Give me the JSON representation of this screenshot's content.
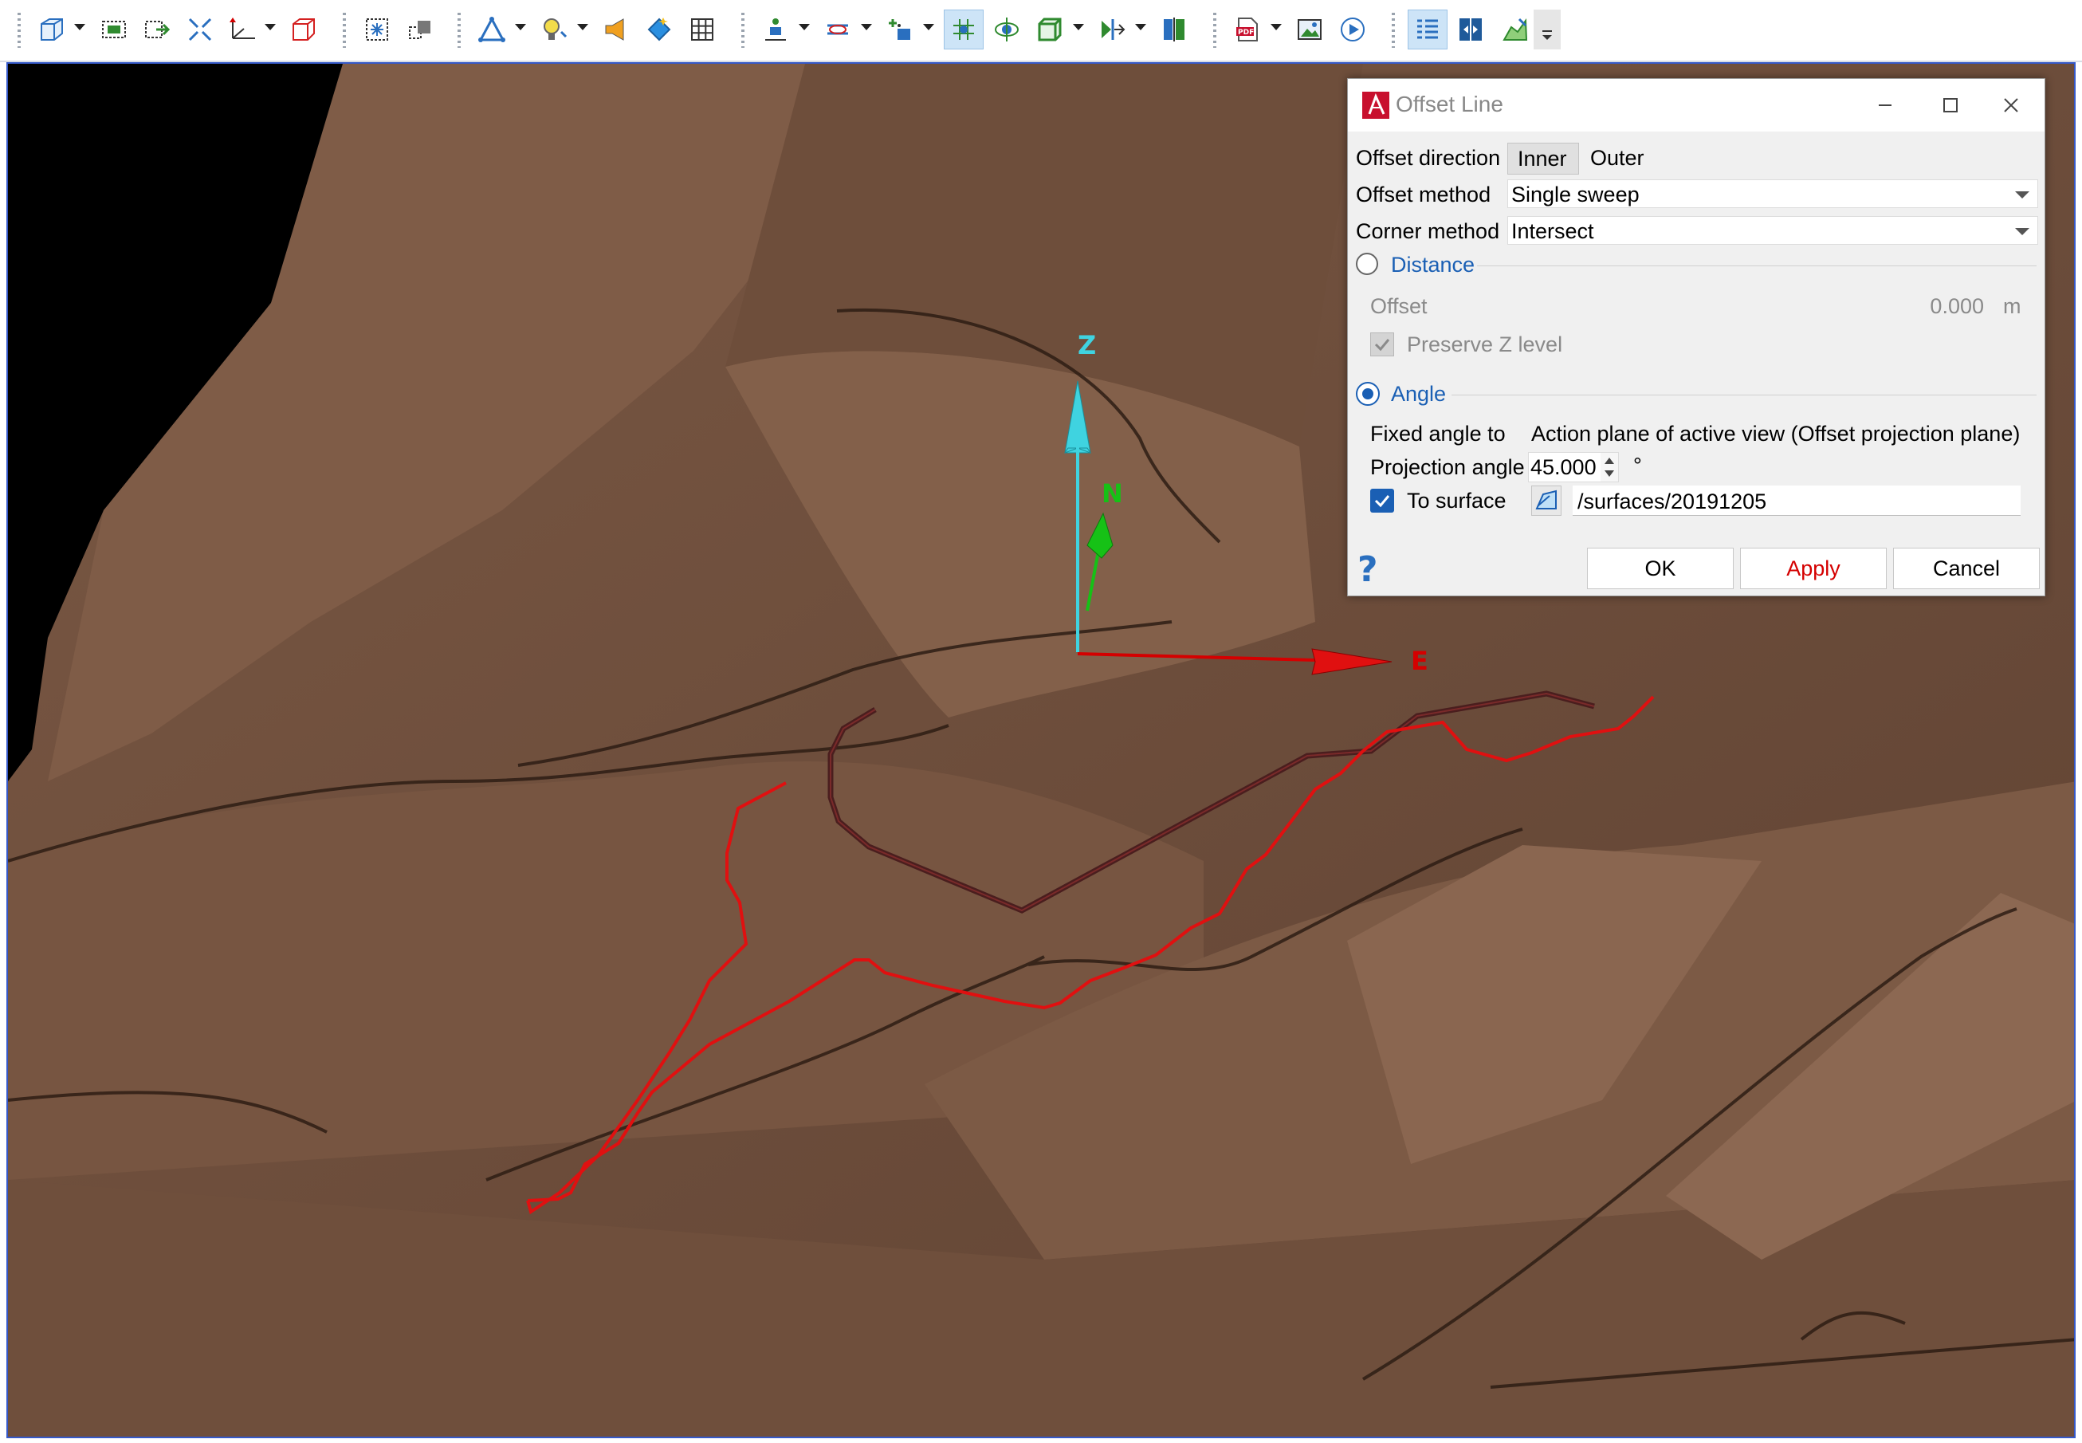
{
  "toolbar": {
    "icons": [
      "view-cube-icon",
      "select-icon",
      "zoom-icon",
      "zoom-extents-icon",
      "axis-icon",
      "box-icon",
      "snap-icon",
      "copy-icon",
      "triangle-icon",
      "light-icon",
      "speaker-icon",
      "diamond-icon",
      "grid-icon",
      "person-icon",
      "measure-icon",
      "add-point-icon",
      "snap-grid-icon",
      "orbit-icon",
      "box-view-icon",
      "section-icon",
      "compare-icon",
      "pdf-icon",
      "image-icon",
      "play-icon",
      "properties-icon",
      "split-icon",
      "surface-icon"
    ]
  },
  "viewport": {
    "axis": {
      "z_label": "Z",
      "n_label": "N",
      "e_label": "E"
    },
    "colors": {
      "terrain": "#6b4c39",
      "red_line": "#e01010",
      "dark_line": "#4a1e1e",
      "z_axis": "#3fd3e0",
      "n_axis": "#16c116",
      "e_axis": "#d40000"
    }
  },
  "dialog": {
    "title": "Offset Line",
    "offset_direction_label": "Offset direction",
    "direction_options": [
      "Inner",
      "Outer"
    ],
    "selected_direction": "Inner",
    "offset_method_label": "Offset method",
    "offset_method_value": "Single sweep",
    "corner_method_label": "Corner method",
    "corner_method_value": "Intersect",
    "distance_label": "Distance",
    "distance_selected": false,
    "offset_label": "Offset",
    "offset_value": "0.000",
    "offset_unit": "m",
    "preserve_z_label": "Preserve Z level",
    "preserve_z_checked": true,
    "angle_label": "Angle",
    "angle_selected": true,
    "fixed_angle_label": "Fixed angle to",
    "fixed_angle_value": "Action plane of active view (Offset projection plane)",
    "projection_angle_label": "Projection angle",
    "projection_angle_value": "45.000",
    "projection_angle_unit": "°",
    "to_surface_label": "To surface",
    "to_surface_checked": true,
    "surface_path": "/surfaces/20191205",
    "ok_label": "OK",
    "apply_label": "Apply",
    "cancel_label": "Cancel",
    "help_glyph": "?"
  }
}
